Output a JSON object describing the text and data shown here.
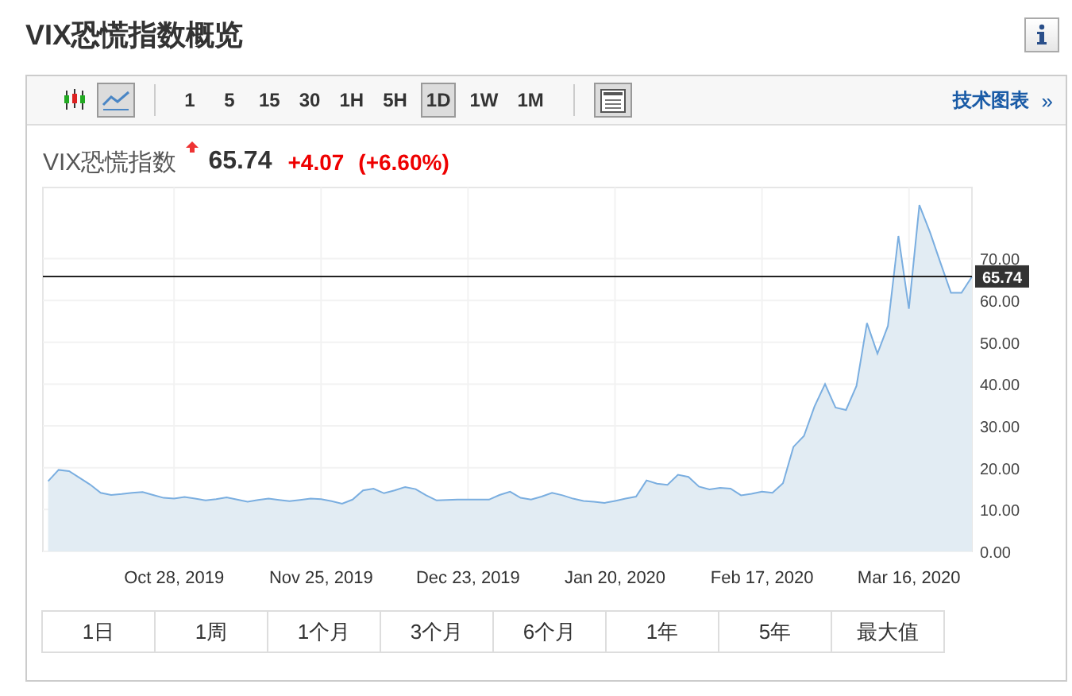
{
  "title": "VIX恐慌指数概览",
  "toolbar": {
    "chart_types": [
      {
        "kind": "candlestick",
        "selected": false
      },
      {
        "kind": "line",
        "selected": true
      }
    ],
    "intervals": [
      {
        "label": "1",
        "selected": false
      },
      {
        "label": "5",
        "selected": false
      },
      {
        "label": "15",
        "selected": false
      },
      {
        "label": "30",
        "selected": false
      },
      {
        "label": "1H",
        "selected": false
      },
      {
        "label": "5H",
        "selected": false
      },
      {
        "label": "1D",
        "selected": true
      },
      {
        "label": "1W",
        "selected": false
      },
      {
        "label": "1M",
        "selected": false
      }
    ],
    "link": "技术图表",
    "link_arrow": "»"
  },
  "quote": {
    "name": "VIX恐慌指数",
    "rising": true,
    "price": "65.74",
    "change": "+4.07",
    "change_percent": "(+6.60%)"
  },
  "chart": {
    "chart_data": {
      "type": "area",
      "grid": true,
      "ref_lines": [
        {
          "axis": "y",
          "value": 65.74
        }
      ],
      "categories": [
        null,
        null,
        null,
        null,
        null,
        null,
        null,
        null,
        null,
        null,
        null,
        null,
        "Oct 28, 2019",
        null,
        null,
        null,
        null,
        null,
        null,
        null,
        null,
        null,
        null,
        null,
        null,
        null,
        "Nov 25, 2019",
        null,
        null,
        null,
        null,
        null,
        null,
        null,
        null,
        null,
        null,
        null,
        null,
        null,
        "Dec 23, 2019",
        null,
        null,
        null,
        null,
        null,
        null,
        null,
        null,
        null,
        null,
        null,
        null,
        null,
        "Jan 20, 2020",
        null,
        null,
        null,
        null,
        null,
        null,
        null,
        null,
        null,
        null,
        null,
        null,
        null,
        "Feb 17, 2020",
        null,
        null,
        null,
        null,
        null,
        null,
        null,
        null,
        null,
        null,
        null,
        null,
        null,
        "Mar 16, 2020",
        null,
        null,
        null,
        null,
        null,
        null
      ],
      "series": [
        {
          "color": "#7aaee0",
          "values": [
            16.8,
            19.5,
            19.2,
            17.6,
            16,
            14,
            13.5,
            13.7,
            14,
            14.2,
            13.5,
            12.8,
            12.6,
            13,
            12.6,
            12.2,
            12.5,
            12.9,
            12.4,
            11.9,
            12.3,
            12.6,
            12.3,
            12,
            12.3,
            12.6,
            12.5,
            12,
            11.4,
            12.4,
            14.6,
            15,
            13.9,
            14.6,
            15.4,
            14.9,
            13.4,
            12.2,
            12.3,
            12.4,
            12.4,
            12.4,
            12.4,
            13.5,
            14.3,
            12.8,
            12.4,
            13.1,
            14,
            13.4,
            12.6,
            12.1,
            11.9,
            11.6,
            12.1,
            12.6,
            13.1,
            17,
            16.2,
            15.9,
            18.3,
            17.8,
            15.5,
            14.8,
            15.2,
            15,
            13.4,
            13.8,
            14.3,
            14,
            16.3,
            25,
            27.6,
            34.6,
            40,
            34.4,
            33.8,
            39.6,
            54.6,
            47.3,
            53.9,
            75.4,
            58,
            82.8,
            76.3,
            69,
            61.8,
            61.8,
            65.7
          ]
        }
      ],
      "ylim": [
        0,
        87
      ],
      "yticks": [
        {
          "value": 0,
          "label": "0.00"
        },
        {
          "value": 10,
          "label": "10.00"
        },
        {
          "value": 20,
          "label": "20.00"
        },
        {
          "value": 30,
          "label": "30.00"
        },
        {
          "value": 40,
          "label": "40.00"
        },
        {
          "value": 50,
          "label": "50.00"
        },
        {
          "value": 60,
          "label": "60.00"
        },
        {
          "value": 70,
          "label": "70.00"
        },
        {
          "value": 65.74,
          "label": "65.74"
        }
      ]
    }
  },
  "ranges": [
    {
      "label": "1日",
      "selected": false
    },
    {
      "label": "1周",
      "selected": false
    },
    {
      "label": "1个月",
      "selected": false
    },
    {
      "label": "3个月",
      "selected": false
    },
    {
      "label": "6个月",
      "selected": false
    },
    {
      "label": "1年",
      "selected": false
    },
    {
      "label": "5年",
      "selected": false
    },
    {
      "label": "最大值",
      "selected": false
    }
  ]
}
